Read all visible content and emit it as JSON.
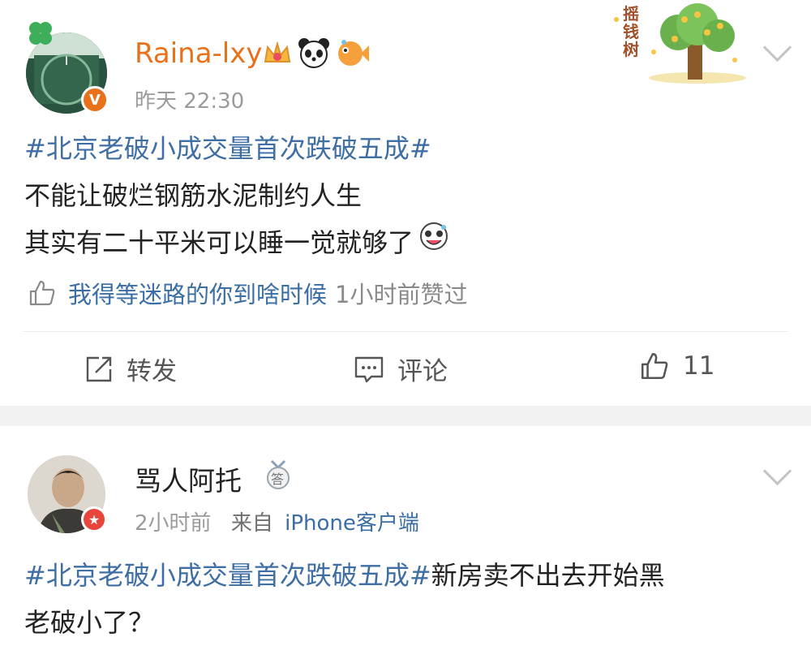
{
  "post": {
    "username": "Raina-lxy",
    "time": "昨天 22:30",
    "hashtag": "#北京老破小成交量首次跌破五成#",
    "line1": "不能让破烂钢筋水泥制约人生",
    "line2": "其实有二十平米可以睡一觉就够了",
    "liked_by": "我得等迷路的你到啥时候",
    "liked_when": "1小时前赞过",
    "sticker_text": [
      "摇",
      "钱",
      "树"
    ],
    "actions": {
      "repost": "转发",
      "comment": "评论",
      "likes": "11"
    },
    "colors": {
      "username": "#e8711a",
      "hashtag": "#3e6ea3",
      "vip_badge": "#e8711a"
    }
  },
  "reply": {
    "username": "骂人阿托",
    "time": "2小时前",
    "source_prefix": "来自",
    "source": "iPhone客户端",
    "hashtag": "#北京老破小成交量首次跌破五成#",
    "text1": "新房卖不出去开始黑",
    "text2": "老破小了？",
    "badge_char": "答"
  }
}
